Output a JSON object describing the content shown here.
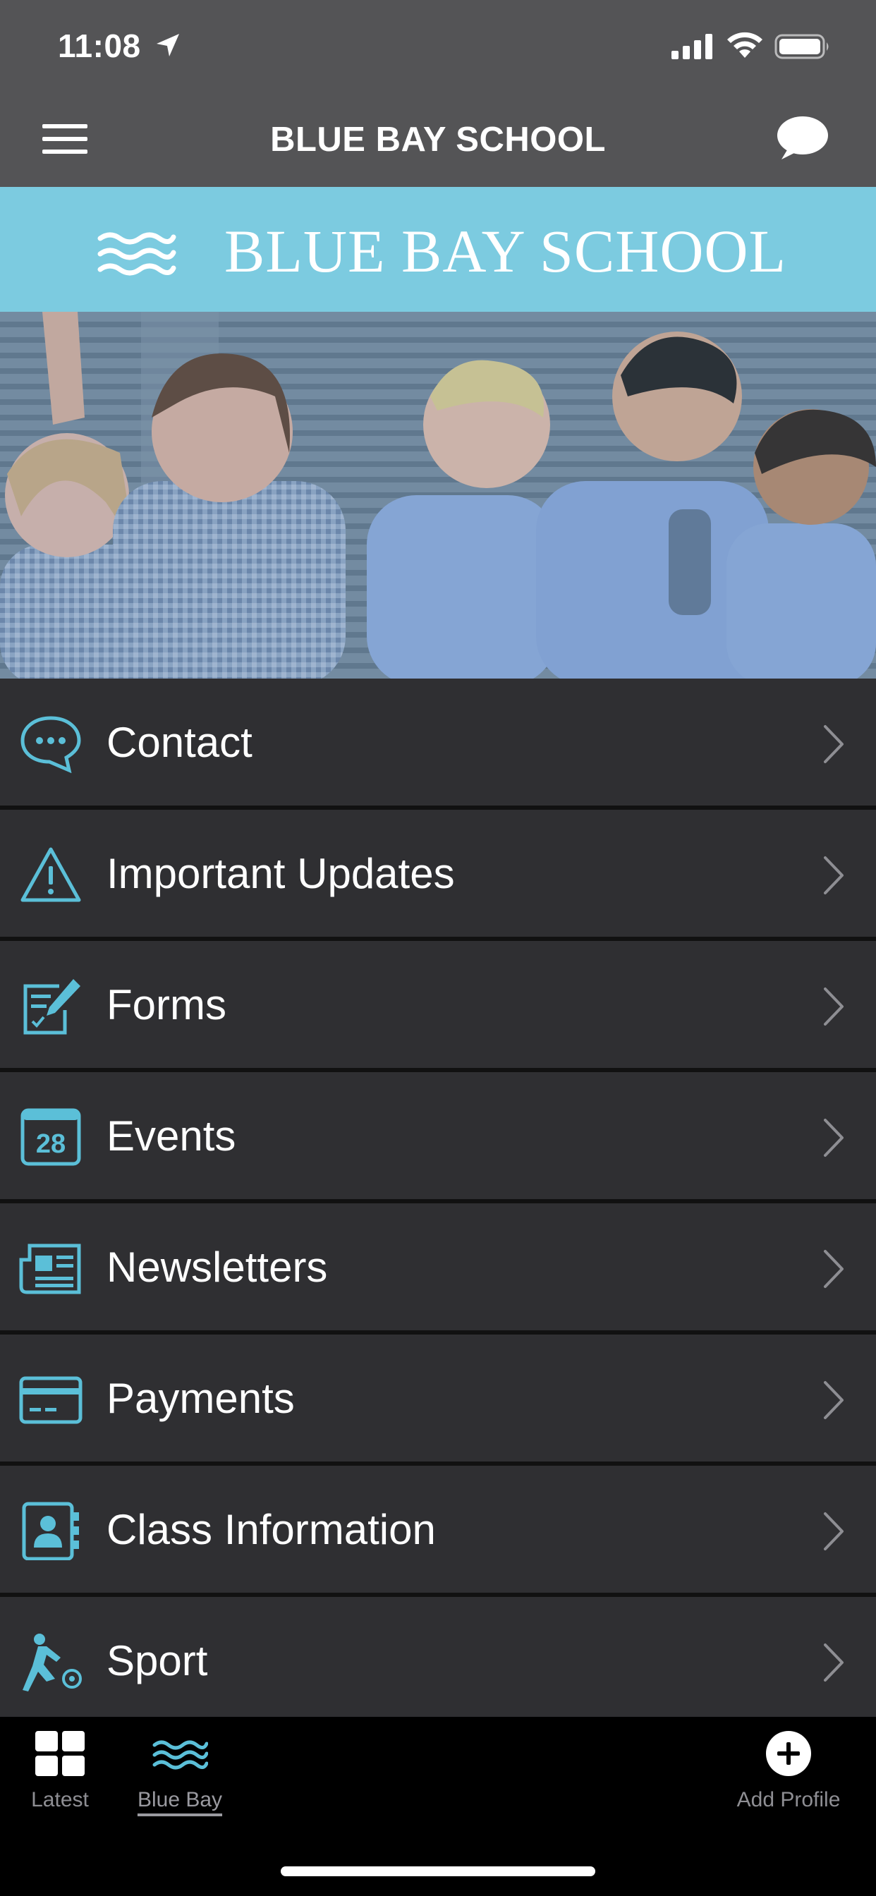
{
  "status_bar": {
    "time": "11:08",
    "icons": [
      "location-arrow-icon",
      "cellular-signal-icon",
      "wifi-icon",
      "battery-icon"
    ]
  },
  "nav_bar": {
    "title": "BLUE BAY SCHOOL",
    "left_icon": "hamburger-menu-icon",
    "right_icon": "chat-bubble-icon"
  },
  "banner": {
    "logo_icon": "waves-icon",
    "text": "BLUE BAY SCHOOL",
    "color": "#7ccbe0"
  },
  "hero": {
    "description_icon": "students-photo"
  },
  "menu": {
    "accent_color": "#5bbfd8",
    "items": [
      {
        "label": "Contact",
        "icon": "chat-dots-icon"
      },
      {
        "label": "Important Updates",
        "icon": "warning-icon"
      },
      {
        "label": "Forms",
        "icon": "form-edit-icon"
      },
      {
        "label": "Events",
        "icon": "calendar-icon",
        "icon_text": "28"
      },
      {
        "label": "Newsletters",
        "icon": "newspaper-icon"
      },
      {
        "label": "Payments",
        "icon": "credit-card-icon"
      },
      {
        "label": "Class Information",
        "icon": "contact-book-icon"
      },
      {
        "label": "Sport",
        "icon": "sport-soccer-icon"
      }
    ]
  },
  "tab_bar": {
    "tabs": [
      {
        "label": "Latest",
        "icon": "grid-icon"
      },
      {
        "label": "Blue Bay",
        "icon": "waves-icon",
        "active": true
      },
      {
        "label": "Add Profile",
        "icon": "plus-circle-icon"
      }
    ]
  }
}
